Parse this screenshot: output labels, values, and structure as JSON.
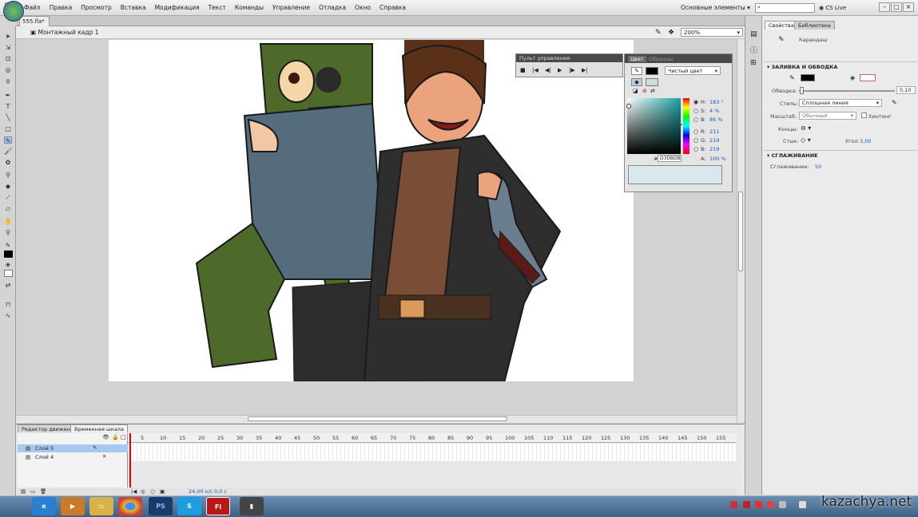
{
  "menubar": {
    "logo": "Fl",
    "items": [
      "Файл",
      "Правка",
      "Просмотр",
      "Вставка",
      "Модификация",
      "Текст",
      "Команды",
      "Управление",
      "Отладка",
      "Окно",
      "Справка"
    ],
    "workspace": "Основные элементы",
    "cs_live": "CS Live",
    "minimize": "–",
    "maximize": "□",
    "close": "×"
  },
  "document": {
    "tab": "555.fla*",
    "scene": "Монтажный кадр 1",
    "zoom": "200%"
  },
  "control_panel": {
    "title": "Пульт управления"
  },
  "color_panel": {
    "tab_active": "Цвет",
    "tab_inactive": "Образцы",
    "fill_type": "Чистый цвет",
    "h_label": "H:",
    "h_value": "183 °",
    "s_label": "S:",
    "s_value": "4 %",
    "b_label": "B:",
    "b_value": "86 %",
    "r_label": "R:",
    "r_value": "211",
    "g_label": "G:",
    "g_value": "219",
    "bb_label": "B:",
    "bb_value": "219",
    "hex_label": "#",
    "hex_value": "D3DBDB",
    "a_label": "A:",
    "a_value": "100 %"
  },
  "properties": {
    "tab_props": "Свойства",
    "tab_library": "Библиотека",
    "tool_name": "Карандаш",
    "section_fill": "ЗАЛИВКА И ОБВОДКА",
    "stroke_label": "Обводка:",
    "stroke_value": "0,10",
    "style_label": "Стиль:",
    "style_value": "Сплошная линия",
    "scale_label": "Масштаб:",
    "scale_value": "Обычный",
    "hinting": "Хинтинг",
    "caps_label": "Концы:",
    "join_label": "Стык:",
    "angle_label": "Угол:",
    "angle_value": "3,00",
    "section_smooth": "СГЛАЖИВАНИЕ",
    "smooth_label": "Сглаживание:",
    "smooth_value": "50"
  },
  "timeline": {
    "tab_motion": "Редактор движения",
    "tab_timeline": "Временная шкала",
    "ticks": [
      "5",
      "10",
      "15",
      "20",
      "25",
      "30",
      "35",
      "40",
      "45",
      "50",
      "55",
      "60",
      "65",
      "70",
      "75",
      "80",
      "85",
      "90",
      "95",
      "100",
      "105",
      "110",
      "115",
      "120",
      "125",
      "130",
      "135",
      "140",
      "145",
      "150",
      "155"
    ],
    "layers": [
      "Слой 5",
      "Слой 4"
    ],
    "fps": "24,00 к/с",
    "time": "0,0 с"
  },
  "taskbar": {
    "apps": [
      "PS",
      "S",
      "Fl"
    ],
    "watermark": "kazachya.net"
  },
  "colors": {
    "accent": "#2a6fb7",
    "stroke": "#000000",
    "fill": "#ffffff",
    "selected_layer": "#a7c8ef"
  }
}
